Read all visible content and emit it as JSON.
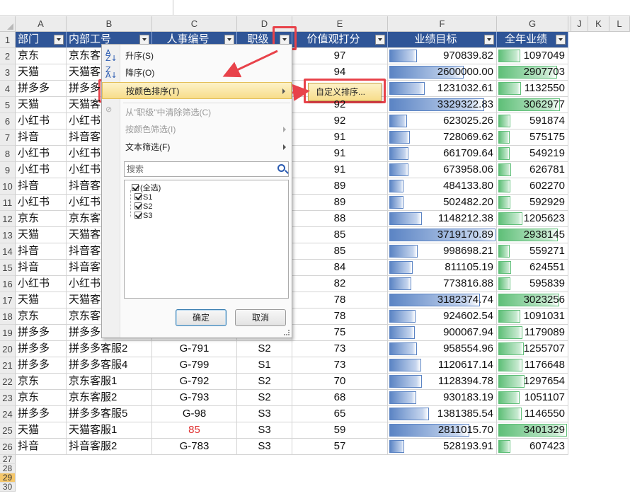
{
  "columns": [
    "A",
    "B",
    "C",
    "D",
    "E",
    "F",
    "G",
    "J",
    "K",
    "L"
  ],
  "row_numbers": [
    "1",
    "2",
    "3",
    "4",
    "5",
    "6",
    "7",
    "8",
    "9",
    "10",
    "11",
    "12",
    "13",
    "14",
    "15",
    "16",
    "17",
    "18",
    "19",
    "20",
    "21",
    "22",
    "23",
    "24",
    "25",
    "26",
    "27",
    "28",
    "29",
    "30"
  ],
  "selected_row": "29",
  "headers": [
    "部门",
    "内部工号",
    "人事编号",
    "职级",
    "价值观打分",
    "业绩目标",
    "全年业绩"
  ],
  "rows": [
    [
      "京东",
      "京东客",
      "",
      "",
      "97",
      "970839.82",
      "1097049"
    ],
    [
      "天猫",
      "天猫客",
      "",
      "",
      "94",
      "2600000.00",
      "2907703"
    ],
    [
      "拼多多",
      "拼多多",
      "",
      "",
      "",
      "1231032.61",
      "1132550"
    ],
    [
      "天猫",
      "天猫客",
      "",
      "",
      "92",
      "3329322.83",
      "3062977"
    ],
    [
      "小红书",
      "小红书",
      "",
      "",
      "92",
      "623025.26",
      "591874"
    ],
    [
      "抖音",
      "抖音客",
      "",
      "",
      "91",
      "728069.62",
      "575175"
    ],
    [
      "小红书",
      "小红书",
      "",
      "",
      "91",
      "661709.64",
      "549219"
    ],
    [
      "小红书",
      "小红书",
      "",
      "",
      "91",
      "673958.06",
      "626781"
    ],
    [
      "抖音",
      "抖音客",
      "",
      "",
      "89",
      "484133.80",
      "602270"
    ],
    [
      "小红书",
      "小红书",
      "",
      "",
      "89",
      "502482.20",
      "592929"
    ],
    [
      "京东",
      "京东客",
      "",
      "",
      "88",
      "1148212.38",
      "1205623"
    ],
    [
      "天猫",
      "天猫客",
      "",
      "",
      "85",
      "3719170.89",
      "2938145"
    ],
    [
      "抖音",
      "抖音客",
      "",
      "",
      "85",
      "998698.21",
      "559271"
    ],
    [
      "抖音",
      "抖音客",
      "",
      "",
      "84",
      "811105.19",
      "624551"
    ],
    [
      "小红书",
      "小红书",
      "",
      "",
      "82",
      "773816.88",
      "595839"
    ],
    [
      "天猫",
      "天猫客",
      "",
      "",
      "78",
      "3182374.74",
      "3023256"
    ],
    [
      "京东",
      "京东客",
      "",
      "",
      "78",
      "924602.54",
      "1091031"
    ],
    [
      "拼多多",
      "拼多多",
      "",
      "",
      "75",
      "900067.94",
      "1179089"
    ],
    [
      "拼多多",
      "拼多多客服2",
      "G-791",
      "S2",
      "73",
      "958554.96",
      "1255707"
    ],
    [
      "拼多多",
      "拼多多客服4",
      "G-799",
      "S1",
      "73",
      "1120617.14",
      "1176648"
    ],
    [
      "京东",
      "京东客服1",
      "G-792",
      "S2",
      "70",
      "1128394.78",
      "1297654"
    ],
    [
      "京东",
      "京东客服2",
      "G-793",
      "S2",
      "68",
      "930183.19",
      "1051107"
    ],
    [
      "拼多多",
      "拼多多客服5",
      "G-98",
      "S3",
      "65",
      "1381385.54",
      "1146550"
    ],
    [
      "天猫",
      "天猫客服1",
      "85",
      "S3",
      "59",
      "2811015.70",
      "3401329"
    ],
    [
      "抖音",
      "抖音客服2",
      "G-783",
      "S3",
      "57",
      "528193.91",
      "607423"
    ]
  ],
  "red_cells": [
    [
      23,
      2
    ]
  ],
  "databar_max_target": 3719170.89,
  "databar_max_total": 3401329,
  "colors": {
    "header_bg": "#2f5597",
    "target_bar": "#5b84c4",
    "total_bar": "#5fbf78",
    "highlight": "#e8424a"
  },
  "menu": {
    "sort_asc": "升序(S)",
    "sort_desc": "降序(O)",
    "sort_by_color": "按颜色排序(T)",
    "clear_filter": "从\"职级\"中清除筛选(C)",
    "filter_by_color": "按颜色筛选(I)",
    "text_filter": "文本筛选(F)",
    "search_placeholder": "搜索",
    "items": [
      "(全选)",
      "S1",
      "S2",
      "S3"
    ],
    "ok": "确定",
    "cancel": "取消"
  },
  "submenu": {
    "custom_sort": "自定义排序..."
  }
}
